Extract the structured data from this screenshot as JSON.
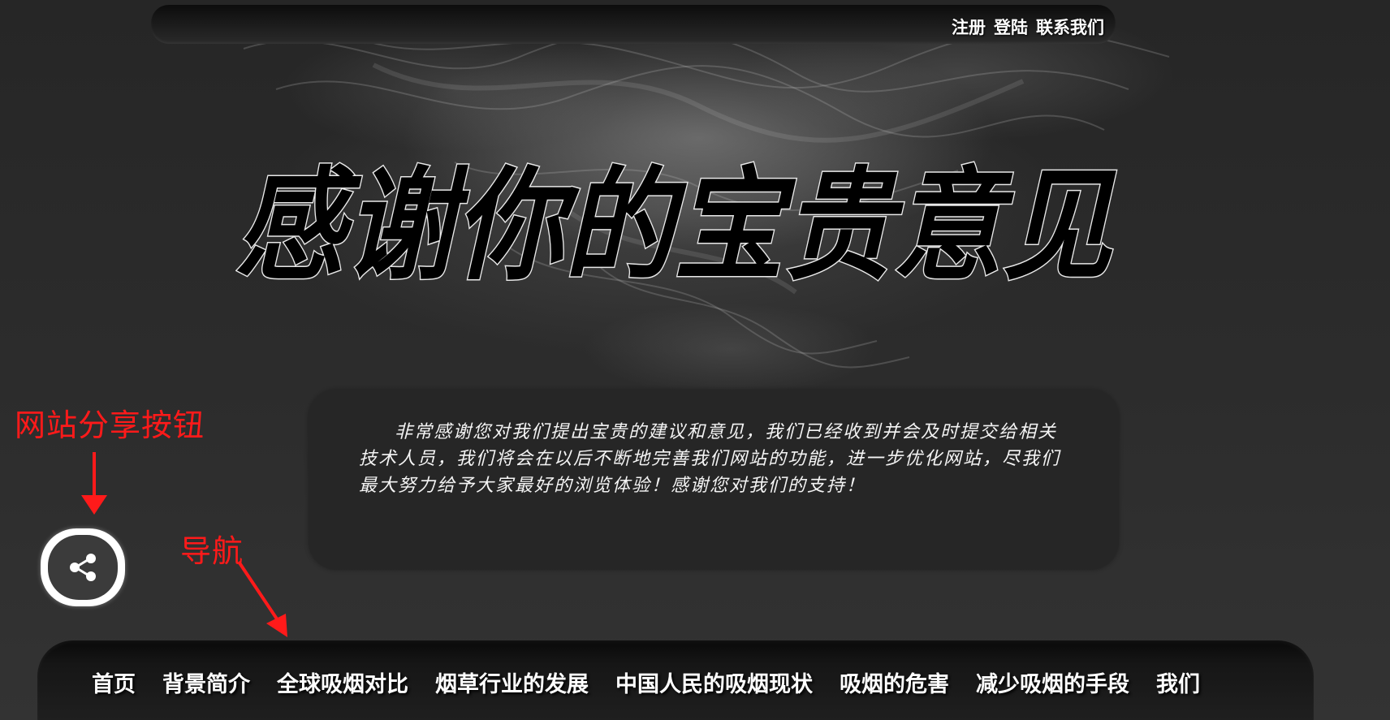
{
  "topbar": {
    "links": [
      "注册",
      "登陆",
      "联系我们"
    ]
  },
  "headline": {
    "text": "感谢你的宝贵意见"
  },
  "message": {
    "text": "非常感谢您对我们提出宝贵的建议和意见，我们已经收到并会及时提交给相关技术人员，我们将会在以后不断地完善我们网站的功能，进一步优化网站，尽我们最大努力给予大家最好的浏览体验！感谢您对我们的支持！"
  },
  "annotations": {
    "share_label": "网站分享按钮",
    "nav_label": "导航",
    "color": "#ff1a1a"
  },
  "share_button": {
    "icon": "share-icon"
  },
  "nav": {
    "items": [
      "首页",
      "背景简介",
      "全球吸烟对比",
      "烟草行业的发展",
      "中国人民的吸烟现状",
      "吸烟的危害",
      "减少吸烟的手段",
      "我们"
    ]
  },
  "colors": {
    "background": "#2a2a2a",
    "bar": "#161616",
    "text": "#ffffff"
  }
}
